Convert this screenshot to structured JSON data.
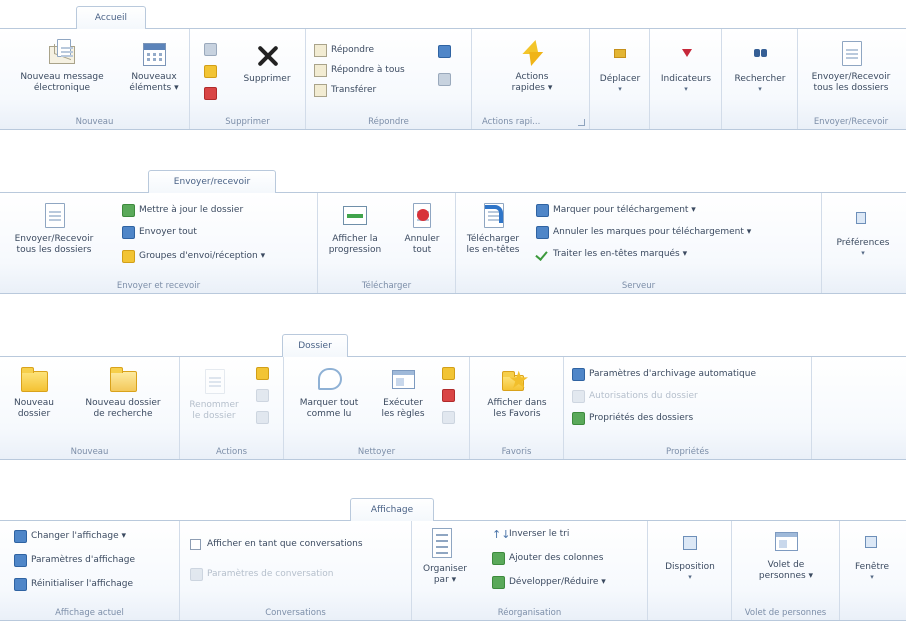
{
  "accueil": {
    "tab": "Accueil",
    "groups": {
      "nouveau": "Nouveau",
      "supprimer": "Supprimer",
      "repondre": "Répondre",
      "actions_rapides": "Actions rapi...",
      "envoyer_recevoir": "Envoyer/Recevoir"
    },
    "buttons": {
      "nouveau_message": [
        "Nouveau message",
        "électronique"
      ],
      "nouveaux_elements": [
        "Nouveaux",
        "éléments ▾"
      ],
      "supprimer": "Supprimer",
      "repondre": "Répondre",
      "repondre_a_tous": "Répondre à tous",
      "transferer": "Transférer",
      "actions_rapides": [
        "Actions",
        "rapides ▾"
      ],
      "deplacer": "Déplacer",
      "indicateurs": "Indicateurs",
      "rechercher": "Rechercher",
      "envoyer_recevoir": [
        "Envoyer/Recevoir",
        "tous les dossiers"
      ]
    }
  },
  "envoyer": {
    "tab": "Envoyer/recevoir",
    "groups": {
      "envoyer_et_recevoir": "Envoyer et recevoir",
      "telecharger": "Télécharger",
      "serveur": "Serveur"
    },
    "buttons": {
      "envoyer_recevoir_tous": [
        "Envoyer/Recevoir",
        "tous les dossiers"
      ],
      "mettre_a_jour": "Mettre à jour le dossier",
      "envoyer_tout": "Envoyer tout",
      "groupes": "Groupes d'envoi/réception ▾",
      "afficher_progression": [
        "Afficher la",
        "progression"
      ],
      "annuler_tout": [
        "Annuler",
        "tout"
      ],
      "telecharger_entetes": [
        "Télécharger",
        "les en-têtes"
      ],
      "marquer": "Marquer pour téléchargement ▾",
      "annuler_marques": "Annuler les marques pour téléchargement ▾",
      "traiter": "Traiter les en-têtes marqués ▾",
      "preferences": "Préférences"
    }
  },
  "dossier": {
    "tab": "Dossier",
    "groups": {
      "nouveau": "Nouveau",
      "actions": "Actions",
      "nettoyer": "Nettoyer",
      "favoris": "Favoris",
      "proprietes": "Propriétés"
    },
    "buttons": {
      "nouveau_dossier": [
        "Nouveau",
        "dossier"
      ],
      "nouveau_dossier_recherche": [
        "Nouveau dossier",
        "de recherche"
      ],
      "renommer": [
        "Renommer",
        "le dossier"
      ],
      "marquer_tout": [
        "Marquer tout",
        "comme lu"
      ],
      "executer_regles": [
        "Exécuter",
        "les règles"
      ],
      "afficher_favoris": [
        "Afficher dans",
        "les Favoris"
      ],
      "archivage": "Paramètres d'archivage automatique",
      "autorisations": "Autorisations du dossier",
      "proprietes": "Propriétés des dossiers"
    }
  },
  "affichage": {
    "tab": "Affichage",
    "groups": {
      "affichage_actuel": "Affichage actuel",
      "conversations": "Conversations",
      "reorganisation": "Réorganisation",
      "volet_personnes": "Volet de personnes"
    },
    "buttons": {
      "changer_affichage": "Changer l'affichage ▾",
      "parametres_affichage": "Paramètres d'affichage",
      "reinitialiser": "Réinitialiser l'affichage",
      "afficher_conversations": "Afficher en tant que conversations",
      "parametres_conversation": "Paramètres de conversation",
      "organiser_par": [
        "Organiser",
        "par ▾"
      ],
      "inverser_tri": "Inverser le tri",
      "ajouter_colonnes": "Ajouter des colonnes",
      "developper_reduire": "Développer/Réduire ▾",
      "disposition": "Disposition",
      "volet_personnes": [
        "Volet de",
        "personnes ▾"
      ],
      "fenetre": "Fenêtre"
    }
  }
}
